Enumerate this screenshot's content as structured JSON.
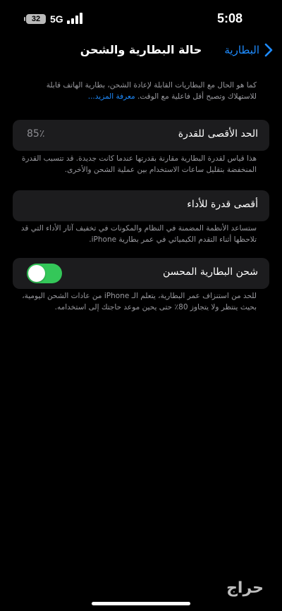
{
  "status_bar": {
    "battery_percent": "32",
    "network": "5G",
    "time": "5:08"
  },
  "nav": {
    "title": "حالة البطارية والشحن",
    "back_label": "البطارية"
  },
  "intro": {
    "text": "كما هو الحال مع البطاريات القابلة لإعادة الشحن، بطارية الهاتف قابلة للاستهلاك وتصبح أقل فاعلية مع الوقت.",
    "link": "معرفة المزيد..."
  },
  "max_capacity": {
    "label": "الحد الأقصى للقدرة",
    "value": "85٪",
    "description": "هذا قياس لقدرة البطارية مقارنة بقدرتها عندما كانت جديدة. قد تتسبب القدرة المنخفضة بتقليل ساعات الاستخدام بين عملية الشحن والأخرى."
  },
  "peak_performance": {
    "label": "أقصى قدرة للأداء",
    "description": "ستساعد الأنظمة المضمنة في النظام والمكونات في تخفيف آثار الأداء التي قد تلاحظها أثناء التقدم الكيميائي في عمر بطارية iPhone."
  },
  "optimized_charging": {
    "label": "شحن البطارية المحسن",
    "enabled": true,
    "description": "للحد من استنزاف عمر البطارية، يتعلم الـ iPhone من عادات الشحن اليومية، بحيث ينتظر ولا يتجاوز 80٪ حتى يحين موعد حاجتك إلى استخدامه."
  },
  "watermark": "حراج",
  "colors": {
    "accent": "#1e8cff",
    "toggle_on": "#34c759",
    "card_bg": "#1c1c1e",
    "secondary_text": "#9a9a9f"
  }
}
